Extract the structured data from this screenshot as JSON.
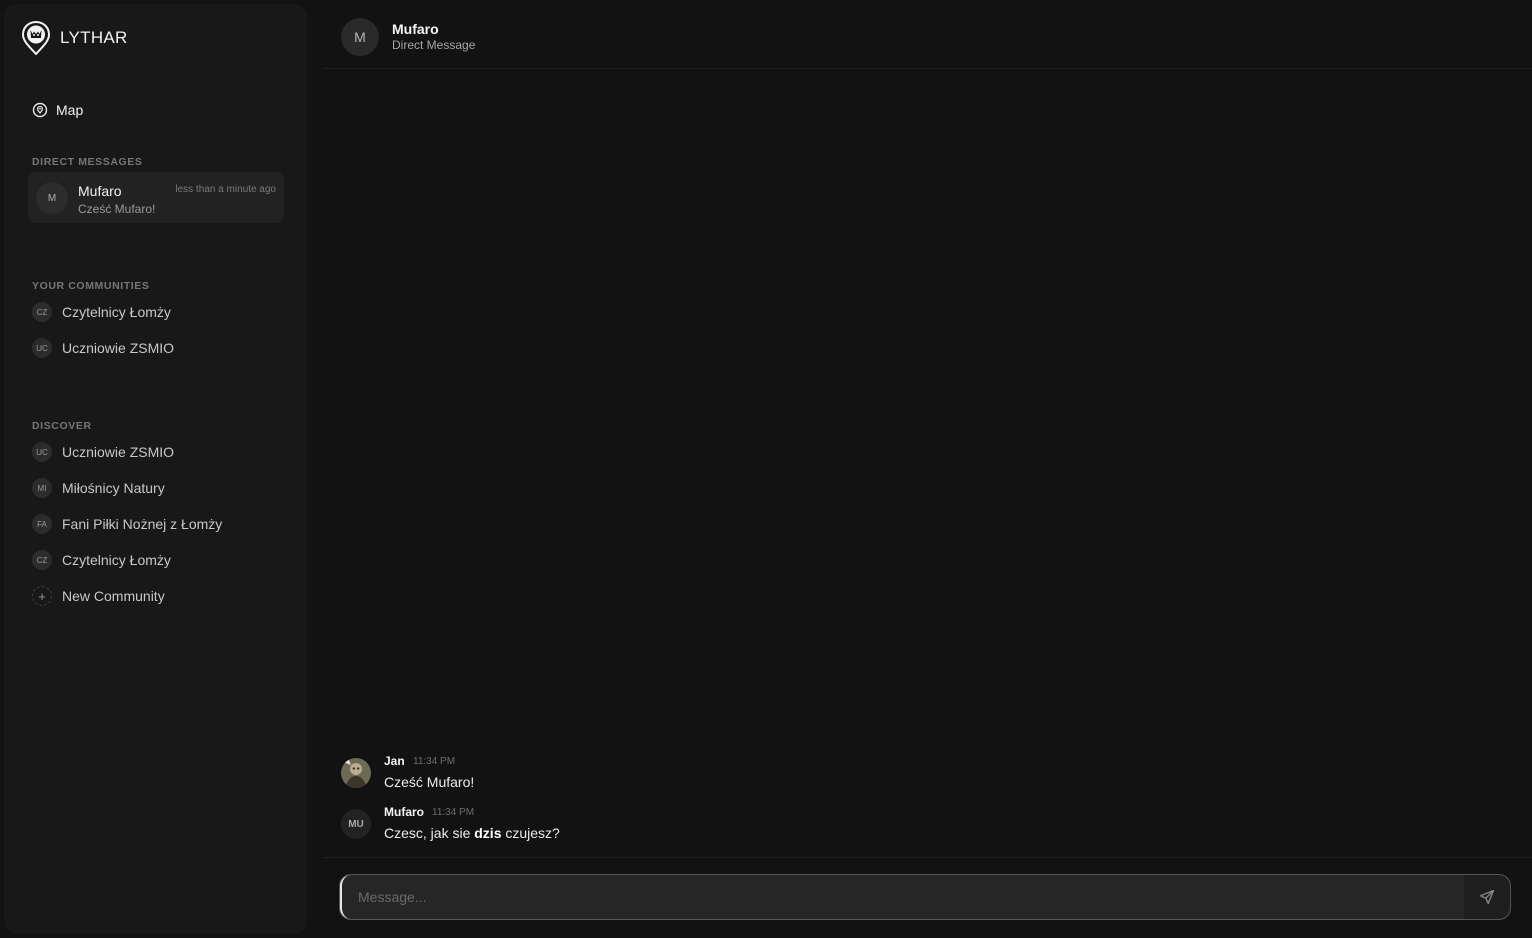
{
  "app": {
    "brand": "LYTHAR"
  },
  "sidebar": {
    "map_label": "Map",
    "direct_messages_title": "DIRECT MESSAGES",
    "direct_messages": [
      {
        "avatar": "M",
        "name": "Mufaro",
        "time": "less than a minute ago",
        "preview": "Cześć Mufaro!"
      }
    ],
    "communities_title": "YOUR COMMUNITIES",
    "communities": [
      {
        "avatar": "CZ",
        "name": "Czytelnicy Łomży"
      },
      {
        "avatar": "UC",
        "name": "Uczniowie ZSMIO"
      }
    ],
    "discover_title": "DISCOVER",
    "discover": [
      {
        "avatar": "UC",
        "name": "Uczniowie ZSMIO"
      },
      {
        "avatar": "MI",
        "name": "Miłośnicy Natury"
      },
      {
        "avatar": "FA",
        "name": "Fani Piłki Nożnej z Łomży"
      },
      {
        "avatar": "CZ",
        "name": "Czytelnicy Łomży"
      }
    ],
    "new_community_label": "New Community",
    "new_community_icon": "plus-icon"
  },
  "chat": {
    "header": {
      "avatar": "M",
      "name": "Mufaro",
      "subtitle": "Direct Message"
    },
    "messages": [
      {
        "author": "Jan",
        "time": "11:34 PM",
        "avatar": "photo",
        "text": "Cześć Mufaro!"
      },
      {
        "author": "Mufaro",
        "time": "11:34 PM",
        "avatar": "MU",
        "text_before": "Czesc, jak sie ",
        "text_bold": "dzis",
        "text_after": " czujesz?"
      }
    ],
    "composer": {
      "placeholder": "Message...",
      "send_icon": "send-icon"
    }
  },
  "colors": {
    "background": "#121212",
    "sidebar": "#181818",
    "selected_item": "#222222",
    "muted_text": "#777777"
  }
}
